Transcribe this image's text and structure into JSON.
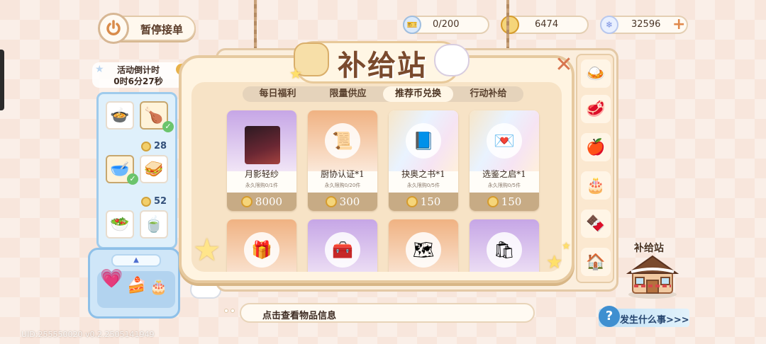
{
  "header": {
    "pause_label": "暂停接单",
    "currencies": [
      {
        "icon": "ticket-icon",
        "value": "0/200"
      },
      {
        "icon": "gold-coin-icon",
        "value": "6474"
      },
      {
        "icon": "snowflake-gem-icon",
        "value": "32596"
      }
    ]
  },
  "countdown": {
    "line1": "活动倒计时",
    "line2": "0时6分27秒",
    "info": "i"
  },
  "vending": {
    "prices": [
      "28",
      "52"
    ]
  },
  "panel": {
    "title": "补给站",
    "close": "✕",
    "tabs": [
      "每日福利",
      "限量供应",
      "推荐币兑换",
      "行动补给"
    ],
    "active_tab": 2,
    "items": [
      {
        "name": "月影轻纱",
        "limit": "永久限购0/1件",
        "price": "8000",
        "icon": "portrait-icon",
        "bg": "purple"
      },
      {
        "name": "厨协认证*1",
        "limit": "永久限购0/20件",
        "price": "300",
        "icon": "certificate-icon",
        "bg": "orange"
      },
      {
        "name": "抉奥之书*1",
        "limit": "永久限购0/5件",
        "price": "150",
        "icon": "book-icon",
        "bg": "rainbow"
      },
      {
        "name": "选鉴之启*1",
        "limit": "永久限购0/5件",
        "price": "150",
        "icon": "envelope-icon",
        "bg": "rainbow"
      },
      {
        "icon": "gift-box-icon",
        "bg": "orange"
      },
      {
        "icon": "purple-chest-icon",
        "bg": "purple"
      },
      {
        "icon": "scroll-icon",
        "bg": "orange"
      },
      {
        "icon": "food-bag-icon",
        "bg": "purple"
      }
    ]
  },
  "info_bar": {
    "text": "点击查看物品信息"
  },
  "what_happened": {
    "q": "?",
    "label": "发生什么事>>>"
  },
  "shop": {
    "label": "补给站"
  },
  "uid_text": "UID:255550020 v0.2.2505141949",
  "colors": {
    "accent": "#e6c99f",
    "price_bar": "#c7ab85",
    "close": "#d8764f"
  }
}
